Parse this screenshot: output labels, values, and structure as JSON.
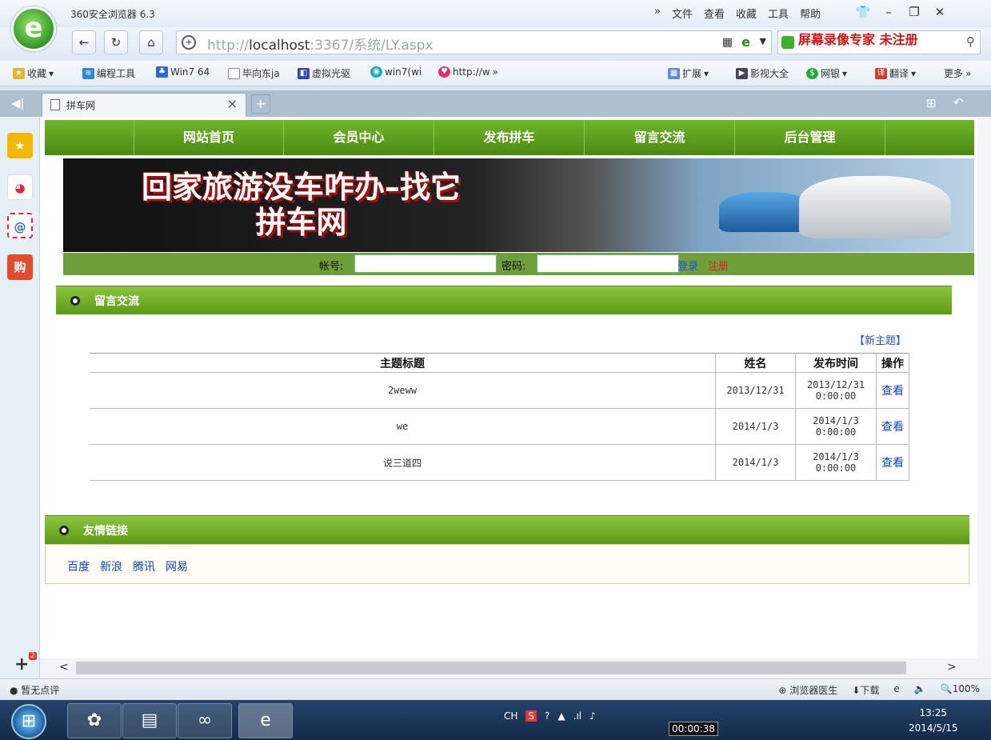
{
  "browser": {
    "title": "360安全浏览器 6.3",
    "menu": [
      "文件",
      "查看",
      "收藏",
      "工具",
      "帮助"
    ],
    "url_host": "http://",
    "url_domain": "localhost",
    "url_path": ":3367/系统/LY.aspx",
    "watermark": "屏幕录像专家  未注册"
  },
  "favorites": [
    {
      "label": "收藏",
      "icon": "star-icon"
    },
    {
      "label": "编程工具",
      "icon": "folder-icon"
    },
    {
      "label": "Win7 64",
      "icon": "paw-icon"
    },
    {
      "label": "毕向东ja",
      "icon": "page-icon"
    },
    {
      "label": "虚拟光驱",
      "icon": "disk-icon"
    },
    {
      "label": "win7(wi",
      "icon": "win-icon"
    },
    {
      "label": "http://w",
      "icon": "heart-icon"
    }
  ],
  "favorites_more": "»",
  "right_tools": [
    {
      "label": "扩展"
    },
    {
      "label": "影视大全"
    },
    {
      "label": "网银"
    },
    {
      "label": "翻译"
    },
    {
      "label": "更多"
    }
  ],
  "tab": {
    "label": "拼车网"
  },
  "site": {
    "nav": [
      "网站首页",
      "会员中心",
      "发布拼车",
      "留言交流",
      "后台管理"
    ],
    "slogan_line1": "回家旅游没车咋办–找它",
    "slogan_line2": "拼车网",
    "login": {
      "account_label": "帐号:",
      "password_label": "密码:",
      "login_link": "登录",
      "register_link": "注册"
    },
    "section_title": "留言交流",
    "new_topic": "【新主题】",
    "table": {
      "headers": [
        "主题标题",
        "姓名",
        "发布时间",
        "操作"
      ],
      "rows": [
        {
          "title": "2weww",
          "name": "2013/12/31",
          "time_date": "2013/12/31",
          "time_clock": "0:00:00",
          "action": "查看"
        },
        {
          "title": "we",
          "name": "2014/1/3",
          "time_date": "2014/1/3",
          "time_clock": "0:00:00",
          "action": "查看"
        },
        {
          "title": "说三道四",
          "name": "2014/1/3",
          "time_date": "2014/1/3",
          "time_clock": "0:00:00",
          "action": "查看"
        }
      ]
    },
    "links_title": "友情链接",
    "links": [
      "百度",
      "新浪",
      "腾讯",
      "网易"
    ]
  },
  "status": {
    "left": "暂无点评",
    "doctor": "浏览器医生",
    "download": "下载",
    "zoom": "100%"
  },
  "taskbar": {
    "ime": "CH",
    "time": "13:25",
    "date": "2014/5/15",
    "recording": "00:00:38"
  },
  "sidebar_badge": "2"
}
